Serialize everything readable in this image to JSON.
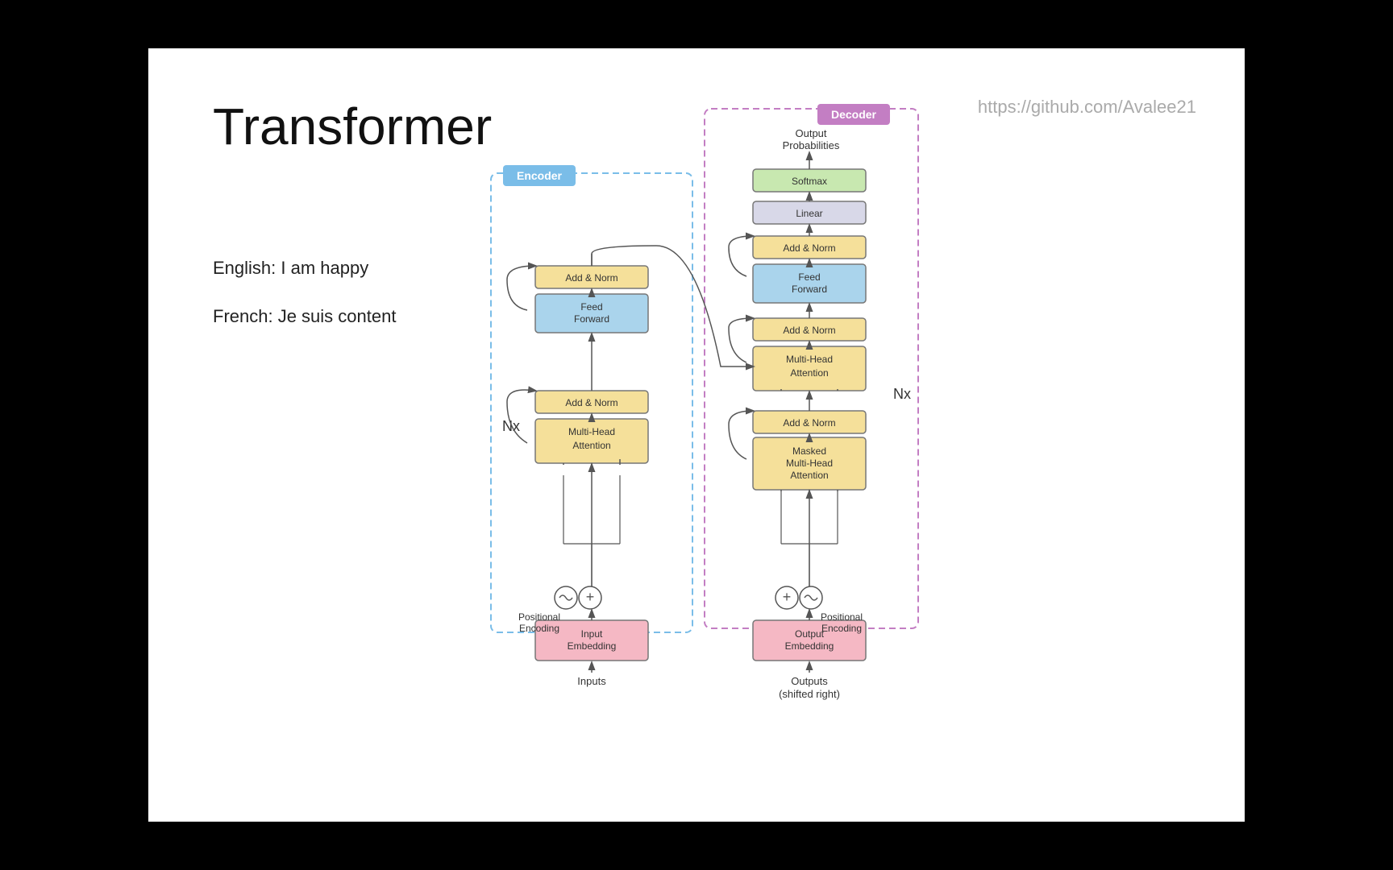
{
  "slide": {
    "title": "Transformer",
    "github": "https://github.com/Avalee21",
    "english": "English: I am happy",
    "french": "French: Je suis content",
    "encoder_label": "Encoder",
    "decoder_label": "Decoder",
    "nx_encoder": "Nx",
    "nx_decoder": "Nx",
    "output_probabilities": "Output\nProbabilities",
    "boxes": {
      "softmax": "Softmax",
      "linear": "Linear",
      "add_norm_dec1": "Add & Norm",
      "feed_forward_dec": "Feed\nForward",
      "add_norm_dec2": "Add & Norm",
      "multi_head_dec": "Multi-Head\nAttention",
      "add_norm_dec3": "Add & Norm",
      "masked_multi_head": "Masked\nMulti-Head\nAttention",
      "add_norm_enc1": "Add & Norm",
      "feed_forward_enc": "Feed\nForward",
      "add_norm_enc2": "Add & Norm",
      "multi_head_enc": "Multi-Head\nAttention",
      "input_embedding": "Input\nEmbedding",
      "output_embedding": "Output\nEmbedding"
    },
    "labels": {
      "positional_encoding_left": "Positional\nEncoding",
      "positional_encoding_right": "Positional\nEncoding",
      "inputs": "Inputs",
      "outputs": "Outputs\n(shifted right)"
    }
  }
}
